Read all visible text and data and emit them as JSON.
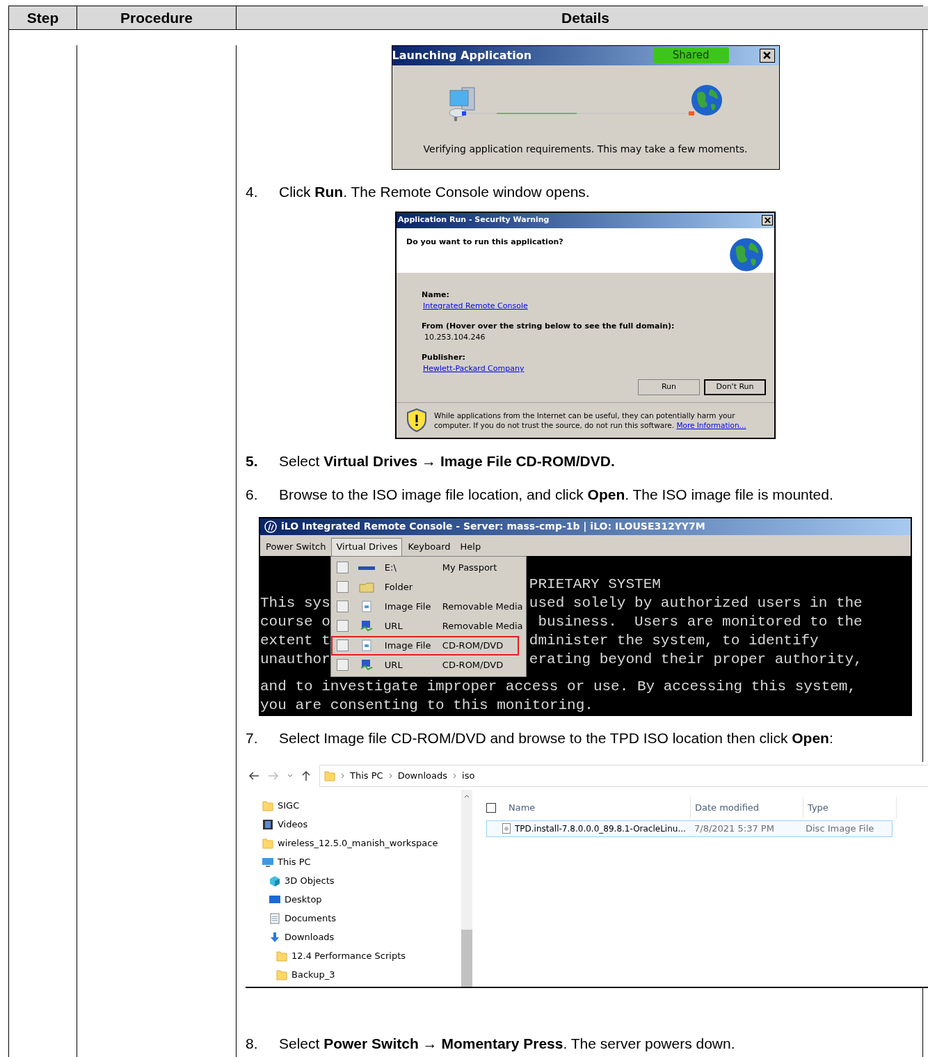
{
  "table": {
    "columns": [
      "Step",
      "Procedure",
      "Details"
    ]
  },
  "details": [
    {
      "kind": "launch_dialog",
      "title": "Launching Application",
      "badge": "Shared",
      "message": "Verifying application requirements. This may take a few moments."
    },
    {
      "kind": "step",
      "number": "4.",
      "text": "Click **Run**. The Remote Console window opens."
    },
    {
      "kind": "security_dialog",
      "title": "Application Run - Security Warning",
      "question": "Do you want to run this application?",
      "fields": [
        {
          "label": "Name:",
          "value": "Integrated Remote Console",
          "kind": "link"
        },
        {
          "label": "From (Hover over the string below to see the full domain):",
          "value": "10.253.104.246",
          "kind": "text"
        },
        {
          "label": "Publisher:",
          "value": "Hewlett-Packard Company",
          "kind": "link"
        }
      ],
      "buttons": [
        "Run",
        "Don't Run"
      ],
      "warning": "While applications from the Internet can be useful, they can potentially harm your computer. If you do not trust the source, do not run this software.",
      "warning_link": "More Information..."
    },
    {
      "kind": "step",
      "number": "**5.**",
      "text": "Select **Virtual Drives → Image File CD-ROM/DVD.**"
    },
    {
      "kind": "step",
      "number": "6.",
      "text": "Browse to the ISO image file location, and click **Open**. The ISO image file is mounted."
    },
    {
      "kind": "console",
      "title": "iLO Integrated Remote Console - Server: mass-cmp-1b | iLO: ILOUSE312YY7M",
      "menus": [
        {
          "label": "Power Switch",
          "selected": false
        },
        {
          "label": "Virtual Drives",
          "selected": true
        },
        {
          "label": "Keyboard",
          "selected": false
        },
        {
          "label": "Help",
          "selected": false
        }
      ],
      "menu_items": [
        {
          "kind": "drive",
          "name": "E:\\",
          "media": "My Passport",
          "checked": false,
          "highlighted": false
        },
        {
          "kind": "folder",
          "name": "Folder",
          "checked": false,
          "highlighted": false
        },
        {
          "kind": "image",
          "name": "Image File",
          "media": "Removable Media",
          "checked": false,
          "highlighted": false
        },
        {
          "kind": "url",
          "name": "URL",
          "media": "Removable Media",
          "checked": false,
          "highlighted": false
        },
        {
          "kind": "image",
          "name": "Image File",
          "media": "CD-ROM/DVD",
          "checked": false,
          "highlighted": true
        },
        {
          "kind": "url",
          "name": "URL",
          "media": "CD-ROM/DVD",
          "checked": false,
          "highlighted": false
        }
      ],
      "lines": [
        {
          "kind": "split",
          "right": "PRIETARY SYSTEM"
        },
        {
          "kind": "split",
          "left": "This sys",
          "right": "used solely by authorized users in the"
        },
        {
          "kind": "split",
          "left": "course o",
          "right": " business.  Users are monitored to the"
        },
        {
          "kind": "split",
          "left": "extent t",
          "right": "dminister the system, to identify"
        },
        {
          "kind": "split",
          "left": "unauthor",
          "right": "erating beyond their proper authority,"
        },
        {
          "kind": "full",
          "text": "and to investigate improper access or use. By accessing this system,"
        },
        {
          "kind": "full",
          "text": "you are consenting to this monitoring."
        }
      ]
    },
    {
      "kind": "step",
      "number": "7.",
      "text": "Select Image file CD-ROM/DVD and browse to the TPD ISO location then click **Open**:"
    },
    {
      "kind": "explorer",
      "path": [
        "This PC",
        "Downloads",
        "iso"
      ],
      "tree": [
        {
          "label": "SIGC",
          "kind": "folder"
        },
        {
          "label": "Videos",
          "kind": "video"
        },
        {
          "label": "wireless_12.5.0_manish_workspace",
          "kind": "folder"
        },
        {
          "label": "This PC",
          "kind": "pc",
          "children": [
            {
              "label": "3D Objects",
              "kind": "cube"
            },
            {
              "label": "Desktop",
              "kind": "desktop"
            },
            {
              "label": "Documents",
              "kind": "document"
            },
            {
              "label": "Downloads",
              "kind": "download",
              "children": [
                {
                  "label": "12.4 Performance Scripts",
                  "kind": "folder"
                },
                {
                  "label": "Backup_3",
                  "kind": "folder"
                }
              ]
            }
          ]
        }
      ],
      "columns": [
        "Name",
        "Date modified",
        "Type"
      ],
      "select_all": {
        "checked": false
      },
      "files": [
        {
          "name": "TPD.install-7.8.0.0.0_89.8.1-OracleLinu...",
          "date": "7/8/2021 5:37 PM",
          "type": "Disc Image File",
          "selected": true
        }
      ]
    },
    {
      "kind": "step",
      "number": "8.",
      "text": "Select **Power Switch → Momentary Press**. The server powers down."
    }
  ]
}
